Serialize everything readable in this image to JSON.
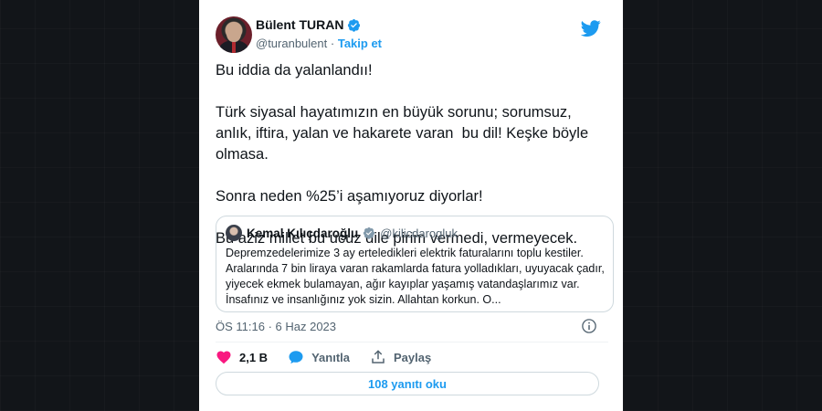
{
  "author": {
    "name": "Bülent TURAN",
    "handle": "@turanbulent",
    "separator": "·",
    "follow_label": "Takip et"
  },
  "tweet": {
    "text": "Bu iddia da yalanlandıı!\n\nTürk siyasal hayatımızın en büyük sorunu; sorumsuz, anlık, iftira, yalan ve hakarete varan  bu dil! Keşke böyle olmasa.\n\nSonra neden %25’i aşamıyoruz diyorlar!\n\nBu aziz millet bu ucuz dile pirim vermedi, vermeyecek."
  },
  "quote": {
    "name": "Kemal Kılıçdaroğlu",
    "handle": "@kilicdarogluk",
    "text": "Depremzedelerimize 3 ay erteledikleri elektrik faturalarını toplu kestiler. Aralarında 7 bin liraya varan rakamlarda fatura yolladıkları, uyuyacak çadır, yiyecek ekmek bulamayan, ağır kayıplar yaşamış vatandaşlarımız var. İnsafınız ve insanlığınız yok sizin. Allahtan korkun. O..."
  },
  "meta": {
    "timestamp": "ÖS 11:16 · 6 Haz 2023"
  },
  "actions": {
    "like_count": "2,1 B",
    "reply_label": "Yanıtla",
    "share_label": "Paylaş"
  },
  "replies_button": "108 yanıtı oku",
  "colors": {
    "accent": "#1d9bf0",
    "like": "#f91880",
    "text": "#0f1419",
    "muted": "#536471"
  },
  "icons": [
    "verified-badge-icon",
    "twitter-bird-icon",
    "info-icon",
    "heart-icon",
    "reply-bubble-icon",
    "share-icon"
  ]
}
